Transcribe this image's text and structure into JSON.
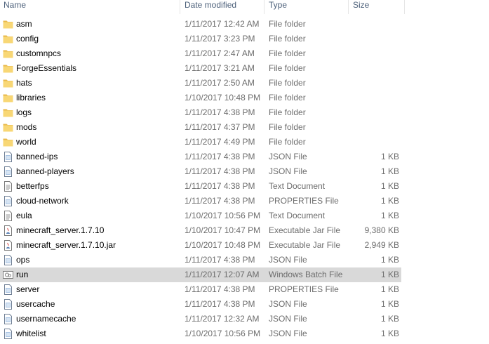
{
  "columns": {
    "name": "Name",
    "date": "Date modified",
    "type": "Type",
    "size": "Size"
  },
  "files": [
    {
      "name": "asm",
      "date": "1/11/2017 12:42 AM",
      "type": "File folder",
      "size": "",
      "icon": "folder-icon"
    },
    {
      "name": "config",
      "date": "1/11/2017 3:23 PM",
      "type": "File folder",
      "size": "",
      "icon": "folder-icon"
    },
    {
      "name": "customnpcs",
      "date": "1/11/2017 2:47 AM",
      "type": "File folder",
      "size": "",
      "icon": "folder-icon"
    },
    {
      "name": "ForgeEssentials",
      "date": "1/11/2017 3:21 AM",
      "type": "File folder",
      "size": "",
      "icon": "folder-icon"
    },
    {
      "name": "hats",
      "date": "1/11/2017 2:50 AM",
      "type": "File folder",
      "size": "",
      "icon": "folder-icon"
    },
    {
      "name": "libraries",
      "date": "1/10/2017 10:48 PM",
      "type": "File folder",
      "size": "",
      "icon": "folder-icon"
    },
    {
      "name": "logs",
      "date": "1/11/2017 4:38 PM",
      "type": "File folder",
      "size": "",
      "icon": "folder-icon"
    },
    {
      "name": "mods",
      "date": "1/11/2017 4:37 PM",
      "type": "File folder",
      "size": "",
      "icon": "folder-icon"
    },
    {
      "name": "world",
      "date": "1/11/2017 4:49 PM",
      "type": "File folder",
      "size": "",
      "icon": "folder-icon"
    },
    {
      "name": "banned-ips",
      "date": "1/11/2017 4:38 PM",
      "type": "JSON File",
      "size": "1 KB",
      "icon": "json-file-icon"
    },
    {
      "name": "banned-players",
      "date": "1/11/2017 4:38 PM",
      "type": "JSON File",
      "size": "1 KB",
      "icon": "json-file-icon"
    },
    {
      "name": "betterfps",
      "date": "1/11/2017 4:38 PM",
      "type": "Text Document",
      "size": "1 KB",
      "icon": "text-file-icon"
    },
    {
      "name": "cloud-network",
      "date": "1/11/2017 4:38 PM",
      "type": "PROPERTIES File",
      "size": "1 KB",
      "icon": "properties-file-icon"
    },
    {
      "name": "eula",
      "date": "1/10/2017 10:56 PM",
      "type": "Text Document",
      "size": "1 KB",
      "icon": "text-file-icon"
    },
    {
      "name": "minecraft_server.1.7.10",
      "date": "1/10/2017 10:47 PM",
      "type": "Executable Jar File",
      "size": "9,380 KB",
      "icon": "jar-file-icon"
    },
    {
      "name": "minecraft_server.1.7.10.jar",
      "date": "1/10/2017 10:48 PM",
      "type": "Executable Jar File",
      "size": "2,949 KB",
      "icon": "jar-file-icon"
    },
    {
      "name": "ops",
      "date": "1/11/2017 4:38 PM",
      "type": "JSON File",
      "size": "1 KB",
      "icon": "json-file-icon"
    },
    {
      "name": "run",
      "date": "1/11/2017 12:07 AM",
      "type": "Windows Batch File",
      "size": "1 KB",
      "icon": "batch-file-icon",
      "selected": true
    },
    {
      "name": "server",
      "date": "1/11/2017 4:38 PM",
      "type": "PROPERTIES File",
      "size": "1 KB",
      "icon": "properties-file-icon"
    },
    {
      "name": "usercache",
      "date": "1/11/2017 4:38 PM",
      "type": "JSON File",
      "size": "1 KB",
      "icon": "json-file-icon"
    },
    {
      "name": "usernamecache",
      "date": "1/11/2017 12:32 AM",
      "type": "JSON File",
      "size": "1 KB",
      "icon": "json-file-icon"
    },
    {
      "name": "whitelist",
      "date": "1/10/2017 10:56 PM",
      "type": "JSON File",
      "size": "1 KB",
      "icon": "json-file-icon"
    }
  ],
  "colors": {
    "header_text": "#4c607a",
    "secondary_text": "#6d6d6d",
    "selected_row": "#d9d9d9",
    "folder": "#f8d775"
  }
}
